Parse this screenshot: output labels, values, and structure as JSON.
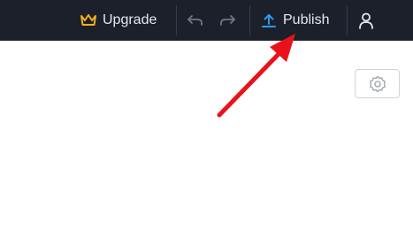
{
  "toolbar": {
    "upgrade_label": "Upgrade",
    "publish_label": "Publish",
    "upgrade_icon": "crown-icon",
    "undo_icon": "undo-icon",
    "redo_icon": "redo-icon",
    "publish_icon": "upload-icon",
    "user_icon": "user-icon"
  },
  "content": {
    "settings_icon": "gear-icon"
  },
  "annotation": {
    "arrow_color": "#e8131a",
    "points_to": "publish-button"
  },
  "colors": {
    "topbar_bg": "#1c202b",
    "upgrade_accent": "#f0b11c",
    "publish_accent": "#2d9cf0"
  }
}
